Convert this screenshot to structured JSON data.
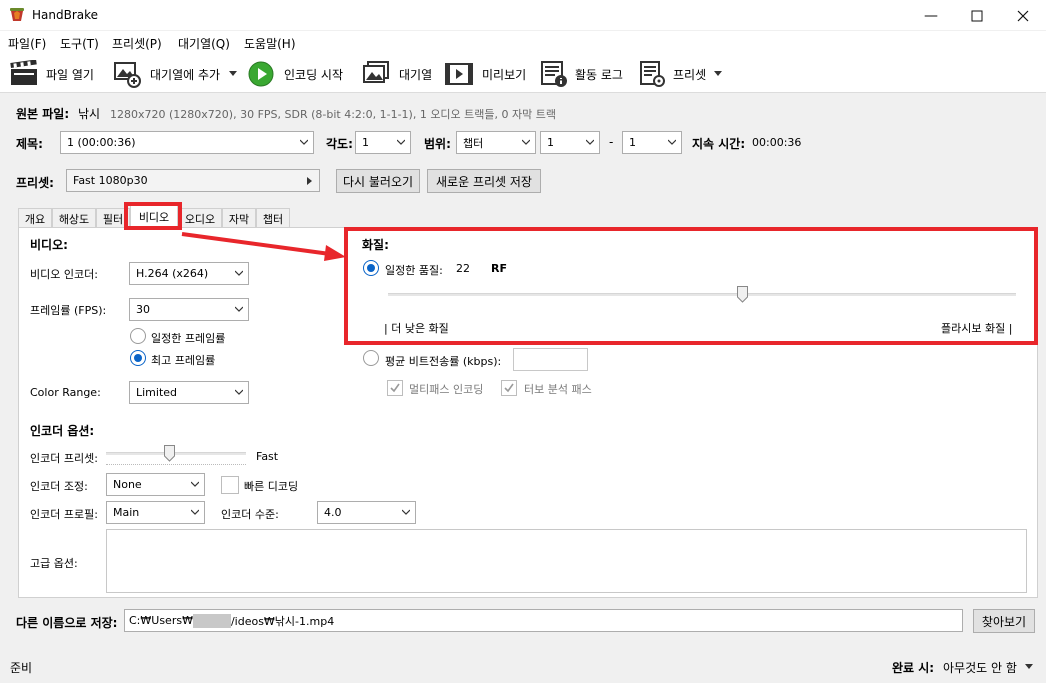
{
  "window": {
    "title": "HandBrake"
  },
  "menu": [
    "파일(F)",
    "도구(T)",
    "프리셋(P)",
    "대기열(Q)",
    "도움말(H)"
  ],
  "toolbar": {
    "open": "파일 열기",
    "add_queue": "대기열에 추가",
    "start": "인코딩 시작",
    "queue": "대기열",
    "preview": "미리보기",
    "activity_log": "활동 로그",
    "presets": "프리셋"
  },
  "source": {
    "label": "원본 파일:",
    "name": "낚시",
    "info": "1280x720 (1280x720), 30 FPS, SDR (8-bit 4:2:0, 1-1-1), 1 오디오 트랙들, 0 자막 트랙"
  },
  "title_row": {
    "title_label": "제목:",
    "title_value": "1  (00:00:36)",
    "angle_label": "각도:",
    "angle_value": "1",
    "range_label": "범위:",
    "range_type": "챕터",
    "range_start": "1",
    "range_dash": "-",
    "range_end": "1",
    "duration_label": "지속 시간:",
    "duration_value": "00:00:36"
  },
  "preset_row": {
    "label": "프리셋:",
    "value": "Fast 1080p30",
    "reload": "다시 불러오기",
    "save_new": "새로운 프리셋 저장"
  },
  "tabs": [
    "개요",
    "해상도",
    "필터",
    "비디오",
    "오디오",
    "자막",
    "챕터"
  ],
  "video": {
    "section": "비디오:",
    "encoder_label": "비디오 인코더:",
    "encoder_value": "H.264 (x264)",
    "fps_label": "프레임률 (FPS):",
    "fps_value": "30",
    "constant_fr": "일정한 프레임률",
    "peak_fr": "최고 프레임률",
    "color_range_label": "Color Range:",
    "color_range_value": "Limited"
  },
  "quality": {
    "section": "화질:",
    "constant_quality": "일정한 품질:",
    "rf_value": "22",
    "rf_unit": "RF",
    "slider_fraction": 0.565,
    "low_label": "| 더 낮은 화질",
    "high_label": "플라시보 화질 |",
    "avg_bitrate": "평균 비트전송률 (kbps):",
    "multipass": "멀티패스 인코딩",
    "turbo": "터보 분석 패스"
  },
  "encoder_options": {
    "section": "인코더 옵션:",
    "preset_label": "인코더 프리셋:",
    "preset_value": "Fast",
    "preset_fraction": 0.45,
    "tune_label": "인코더 조정:",
    "tune_value": "None",
    "fast_decode": "빠른 디코딩",
    "profile_label": "인코더 프로필:",
    "profile_value": "Main",
    "level_label": "인코더 수준:",
    "level_value": "4.0",
    "advanced_label": "고급 옵션:"
  },
  "save": {
    "label": "다른 이름으로 저장:",
    "path_prefix": "C:₩Users₩",
    "path_suffix": "/ideos₩낚시-1.mp4",
    "browse": "찾아보기"
  },
  "status": {
    "left": "준비",
    "done_label": "완료 시:",
    "done_value": "아무것도 안 함"
  },
  "colors": {
    "accent": "#0a64c8",
    "highlight": "#e8262b"
  }
}
